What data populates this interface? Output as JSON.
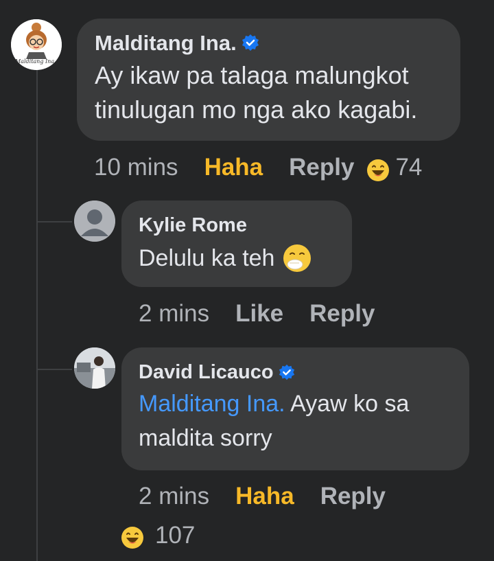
{
  "comments": [
    {
      "author": "Malditang Ina.",
      "verified": true,
      "avatar_caption": "Malditang Ina",
      "text": "Ay ikaw pa talaga malungkot tinulugan mo nga ako kagabi.",
      "time": "10 mins",
      "reaction_action": "Haha",
      "reply_label": "Reply",
      "reaction_icon": "haha-emoji-icon",
      "reaction_count": "74"
    }
  ],
  "replies": [
    {
      "author": "Kylie Rome",
      "verified": false,
      "text": "Delulu ka teh",
      "text_emoji": "face-with-hand-over-mouth-icon",
      "time": "2 mins",
      "like_label": "Like",
      "reply_label": "Reply"
    },
    {
      "author": "David Licauco",
      "verified": true,
      "mention": "Malditang Ina.",
      "text": " Ayaw ko sa maldita sorry",
      "time": "2 mins",
      "reaction_action": "Haha",
      "reply_label": "Reply",
      "reaction_icon": "haha-emoji-icon",
      "reaction_count": "107"
    }
  ],
  "colors": {
    "background": "#242526",
    "bubble": "#3a3b3c",
    "text": "#e4e6eb",
    "muted": "#b0b3b8",
    "haha": "#f7b928",
    "mention": "#4599ff",
    "verified": "#1877f2"
  }
}
